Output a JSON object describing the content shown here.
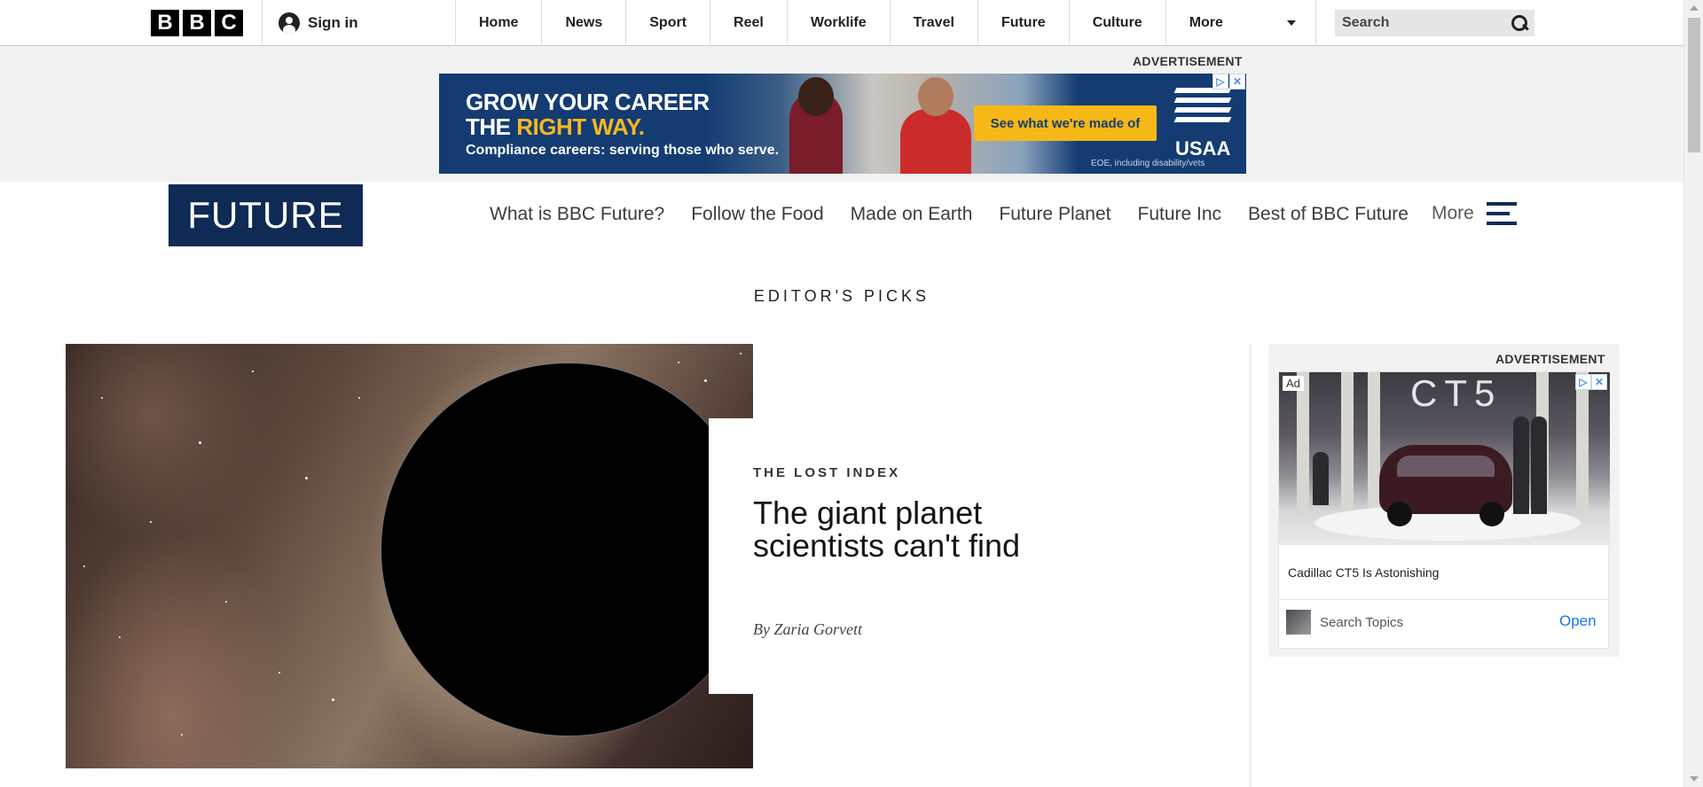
{
  "global_nav": {
    "logo_letters": [
      "B",
      "B",
      "C"
    ],
    "sign_in": "Sign in",
    "items": [
      "Home",
      "News",
      "Sport",
      "Reel",
      "Worklife",
      "Travel",
      "Future",
      "Culture"
    ],
    "more": "More",
    "search_placeholder": "Search"
  },
  "top_ad": {
    "label": "ADVERTISEMENT",
    "headline_line1": "GROW YOUR CAREER",
    "headline_line2_white": "THE ",
    "headline_line2_yellow": "RIGHT WAY.",
    "subline": "Compliance careers: serving those who serve.",
    "cta": "See what we're made of",
    "brand": "USAA",
    "fineprint": "EOE, including disability/vets",
    "adchoices_icon": "adchoices-icon",
    "close_icon": "close-icon"
  },
  "future_header": {
    "logo": "FUTURE",
    "nav": [
      "What is BBC Future?",
      "Follow the Food",
      "Made on Earth",
      "Future Planet",
      "Future Inc",
      "Best of BBC Future"
    ],
    "more": "More",
    "menu_icon": "hamburger-icon"
  },
  "section_title": "EDITOR'S PICKS",
  "hero": {
    "kicker": "THE LOST INDEX",
    "headline": "The giant planet scientists can't find",
    "byline": "By Zaria Gorvett"
  },
  "side_ad": {
    "label": "ADVERTISEMENT",
    "badge": "Ad",
    "image_text": "CT5",
    "caption": "Cadillac CT5 Is Astonishing",
    "search_topics": "Search Topics",
    "open": "Open"
  },
  "colors": {
    "future_blue": "#0e2a55",
    "usaa_blue": "#143c73",
    "usaa_yellow": "#f6b817",
    "open_link": "#1a73e8"
  }
}
